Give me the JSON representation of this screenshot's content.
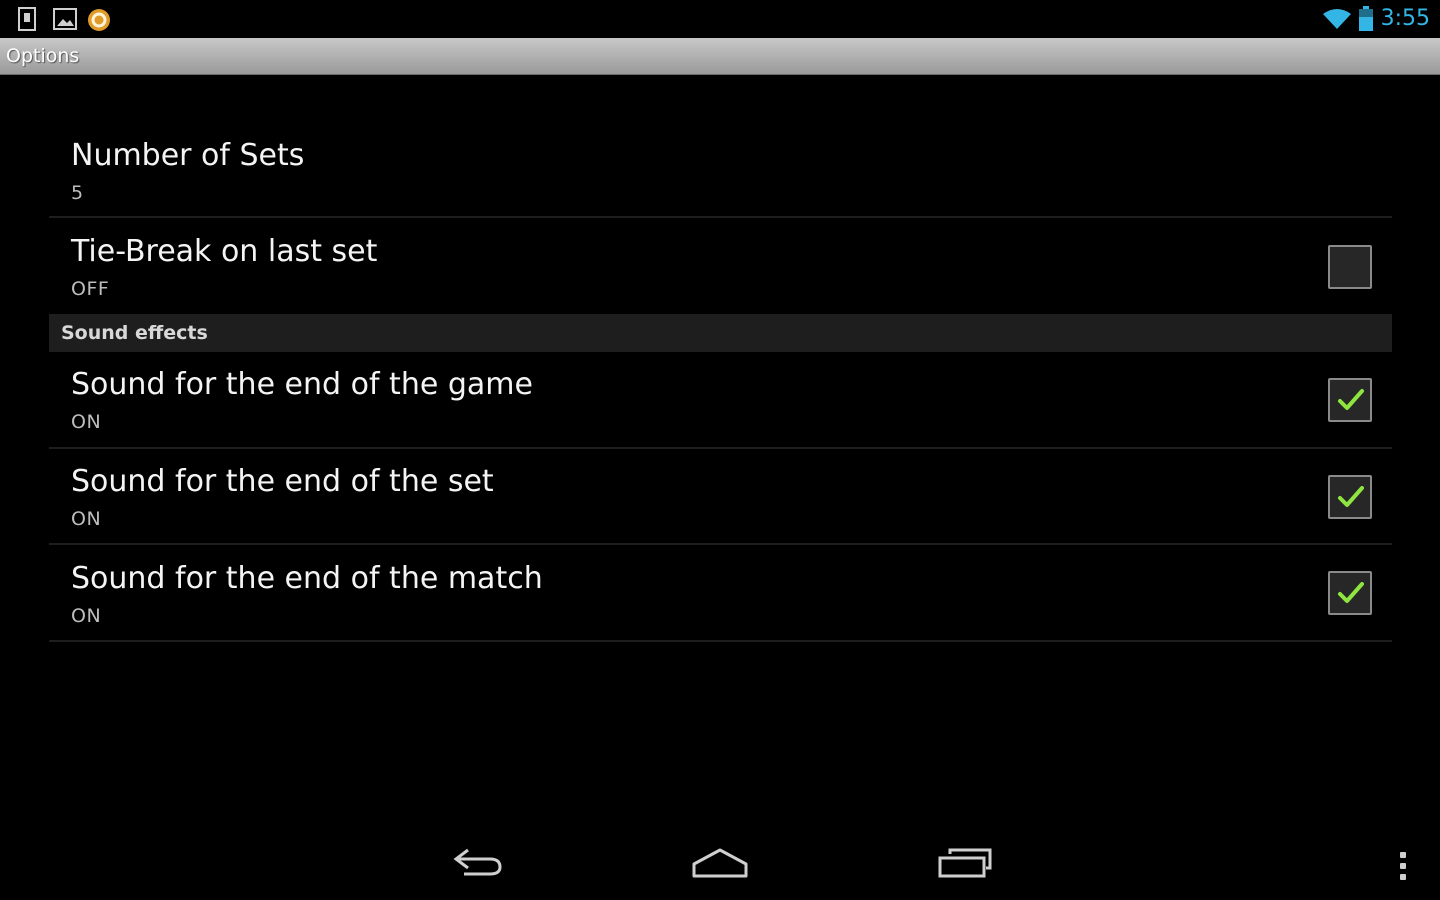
{
  "status_bar": {
    "time": "3:55",
    "notifications": [
      "sd-card-icon",
      "gallery-icon",
      "app-notification-icon"
    ],
    "system_icons": [
      "wifi-icon",
      "battery-icon"
    ],
    "accent_color": "#33b5e5"
  },
  "title_bar": {
    "title": "Options"
  },
  "preferences": {
    "number_of_sets": {
      "title": "Number of Sets",
      "summary": "5"
    },
    "tie_break": {
      "title": "Tie-Break on last set",
      "summary": "OFF",
      "checked": false
    },
    "category": {
      "label": "Sound effects"
    },
    "sound_game": {
      "title": "Sound for the end of the game",
      "summary": "ON",
      "checked": true
    },
    "sound_set": {
      "title": "Sound for the end of the set",
      "summary": "ON",
      "checked": true
    },
    "sound_match": {
      "title": "Sound for the end of the match",
      "summary": "ON",
      "checked": true
    },
    "check_color": "#8ee53f"
  },
  "nav_bar": {
    "buttons": [
      "back-icon",
      "home-icon",
      "recent-apps-icon",
      "overflow-menu-icon"
    ]
  }
}
